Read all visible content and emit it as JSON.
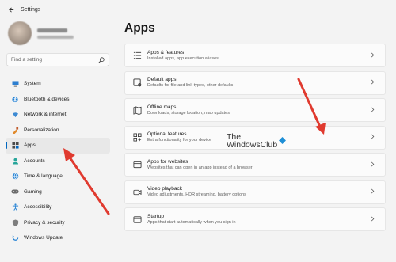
{
  "window": {
    "title": "Settings"
  },
  "search": {
    "placeholder": "Find a setting"
  },
  "sidebar": {
    "items": [
      {
        "label": "System",
        "icon": "system-icon"
      },
      {
        "label": "Bluetooth & devices",
        "icon": "bluetooth-icon"
      },
      {
        "label": "Network & internet",
        "icon": "network-icon"
      },
      {
        "label": "Personalization",
        "icon": "personalization-icon"
      },
      {
        "label": "Apps",
        "icon": "apps-icon",
        "active": true
      },
      {
        "label": "Accounts",
        "icon": "accounts-icon"
      },
      {
        "label": "Time & language",
        "icon": "time-language-icon"
      },
      {
        "label": "Gaming",
        "icon": "gaming-icon"
      },
      {
        "label": "Accessibility",
        "icon": "accessibility-icon"
      },
      {
        "label": "Privacy & security",
        "icon": "privacy-icon"
      },
      {
        "label": "Windows Update",
        "icon": "windows-update-icon"
      }
    ]
  },
  "main": {
    "heading": "Apps",
    "cards": [
      {
        "title": "Apps & features",
        "subtitle": "Installed apps, app execution aliases",
        "icon": "apps-features-icon"
      },
      {
        "title": "Default apps",
        "subtitle": "Defaults for file and link types, other defaults",
        "icon": "default-apps-icon"
      },
      {
        "title": "Offline maps",
        "subtitle": "Downloads, storage location, map updates",
        "icon": "offline-maps-icon"
      },
      {
        "title": "Optional features",
        "subtitle": "Extra functionality for your device",
        "icon": "optional-features-icon"
      },
      {
        "title": "Apps for websites",
        "subtitle": "Websites that can open in an app instead of a browser",
        "icon": "apps-websites-icon"
      },
      {
        "title": "Video playback",
        "subtitle": "Video adjustments, HDR streaming, battery options",
        "icon": "video-playback-icon"
      },
      {
        "title": "Startup",
        "subtitle": "Apps that start automatically when you sign in",
        "icon": "startup-icon"
      }
    ]
  },
  "watermark": {
    "line1": "The",
    "line2": "WindowsClub"
  },
  "colors": {
    "accent": "#0067c0",
    "arrow": "#e03a2f",
    "background": "#f3f3f3",
    "card": "#fbfbfb"
  }
}
